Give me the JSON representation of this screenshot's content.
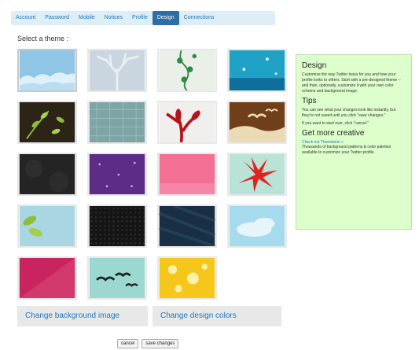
{
  "tabs": [
    "Account",
    "Password",
    "Mobile",
    "Notices",
    "Profile",
    "Design",
    "Connections"
  ],
  "active_tab": "Design",
  "heading": "Select a theme :",
  "themes": [
    {
      "name": "Sky clouds",
      "bg": "#8fc6e6"
    },
    {
      "name": "Pale tree",
      "bg": "#c9d6e0"
    },
    {
      "name": "Vine",
      "bg": "#eaefe8"
    },
    {
      "name": "Sparkle",
      "bg": "#1fa2c6"
    },
    {
      "name": "Leaves",
      "bg": "#2d2418"
    },
    {
      "name": "Teal texture",
      "bg": "#7ea4a5"
    },
    {
      "name": "Red plant",
      "bg": "#f0efee"
    },
    {
      "name": "Brown birds",
      "bg": "#6f3f1a"
    },
    {
      "name": "Dark",
      "bg": "#242424"
    },
    {
      "name": "Purple stars",
      "bg": "#5b2d86"
    },
    {
      "name": "Pink",
      "bg": "#f36f94"
    },
    {
      "name": "Red flower",
      "bg": "#b9e3d6"
    },
    {
      "name": "Leaf",
      "bg": "#a8d7e3"
    },
    {
      "name": "Black dots",
      "bg": "#151515"
    },
    {
      "name": "Navy",
      "bg": "#1a2f44"
    },
    {
      "name": "Cloud",
      "bg": "#a6dbee"
    },
    {
      "name": "Crimson",
      "bg": "#c9245f"
    },
    {
      "name": "Birds",
      "bg": "#9ad8d0"
    },
    {
      "name": "Yellow flowers",
      "bg": "#f5c61c"
    }
  ],
  "buttons": {
    "change_bg": "Change background image",
    "change_colors": "Change design colors",
    "cancel": "cancel",
    "save": "save changes"
  },
  "sidebar": {
    "design_title": "Design",
    "design_text": "Customize the way Twitter looks for you and how your profile looks to others. Start with a pre-designed theme -- and then, optionally, customize it with your own color scheme and background image.",
    "tips_title": "Tips",
    "tips_text1": "You can see what your changes look like instantly, but they're not saved until you click \"save changes.\"",
    "tips_text2": "If you want to start over, click \"cancel.\"",
    "creative_title": "Get more creative",
    "creative_link": "Check out Themeleon »",
    "creative_text": "Thousands of background patterns & color palettes available to customize your Twitter profile."
  }
}
